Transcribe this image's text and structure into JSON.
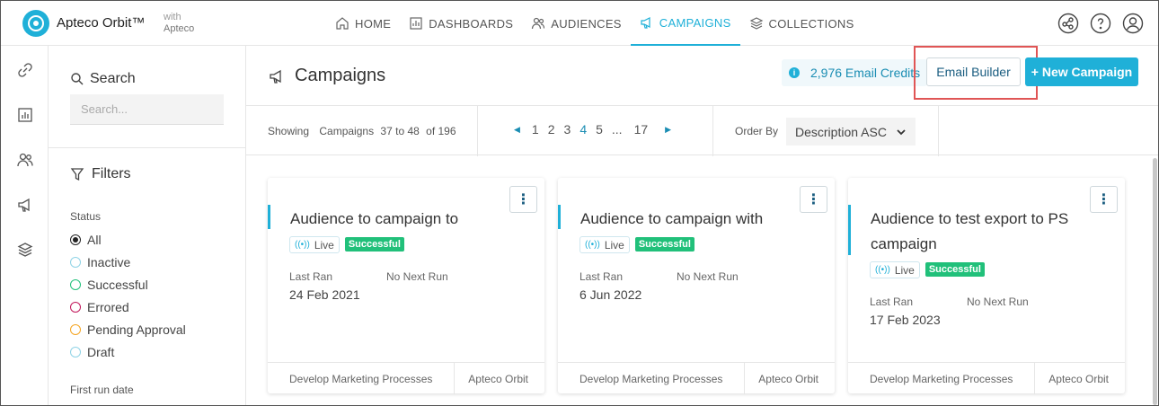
{
  "app": {
    "brand": "Apteco Orbit™",
    "brand_with_line1": "with",
    "brand_with_line2": "Apteco"
  },
  "nav": [
    {
      "label": "HOME",
      "icon": "home-icon"
    },
    {
      "label": "DASHBOARDS",
      "icon": "chart-icon"
    },
    {
      "label": "AUDIENCES",
      "icon": "people-icon"
    },
    {
      "label": "CAMPAIGNS",
      "icon": "megaphone-icon",
      "active": true
    },
    {
      "label": "COLLECTIONS",
      "icon": "layers-icon"
    }
  ],
  "top_icons": [
    "share-icon",
    "help-icon",
    "user-icon"
  ],
  "rail_icons": [
    "link-icon",
    "chart-icon",
    "people-icon",
    "megaphone-icon",
    "layers-icon"
  ],
  "panel": {
    "search_title": "Search",
    "search_placeholder": "Search...",
    "filters_title": "Filters",
    "status_label": "Status",
    "statuses": [
      {
        "label": "All",
        "color": "#222222",
        "selected": true
      },
      {
        "label": "Inactive",
        "color": "#8fd3e6"
      },
      {
        "label": "Successful",
        "color": "#21c07a"
      },
      {
        "label": "Errored",
        "color": "#c2185b"
      },
      {
        "label": "Pending Approval",
        "color": "#f5a623"
      },
      {
        "label": "Draft",
        "color": "#8fd3e6"
      }
    ],
    "first_run_label": "First run date"
  },
  "main": {
    "title": "Campaigns",
    "credits": "2,976 Email Credits",
    "email_builder": "Email Builder",
    "new_campaign": "+ New Campaign",
    "showing": {
      "prefix": "Showing",
      "entity": "Campaigns",
      "range": "37 to 48",
      "total": "of 196"
    },
    "pages": [
      "1",
      "2",
      "3",
      "4",
      "5",
      "...",
      "17"
    ],
    "current_page": "4",
    "order_by_label": "Order By",
    "order_by_value": "Description ASC"
  },
  "cards": [
    {
      "title": "Audience to campaign to",
      "live": "Live",
      "status": "Successful",
      "last_ran_label": "Last Ran",
      "next_run": "No Next Run",
      "last_ran": "24 Feb 2021",
      "footer_left": "Develop Marketing Processes",
      "footer_right": "Apteco Orbit"
    },
    {
      "title": "Audience to campaign with",
      "live": "Live",
      "status": "Successful",
      "last_ran_label": "Last Ran",
      "next_run": "No Next Run",
      "last_ran": "6 Jun 2022",
      "footer_left": "Develop Marketing Processes",
      "footer_right": "Apteco Orbit"
    },
    {
      "title": "Audience to test export to PS campaign",
      "live": "Live",
      "status": "Successful",
      "last_ran_label": "Last Ran",
      "next_run": "No Next Run",
      "last_ran": "17 Feb 2023",
      "footer_left": "Develop Marketing Processes",
      "footer_right": "Apteco Orbit"
    }
  ],
  "colors": {
    "accent": "#1fb0d8",
    "success": "#21c07a",
    "highlight_box": "#e05555"
  }
}
